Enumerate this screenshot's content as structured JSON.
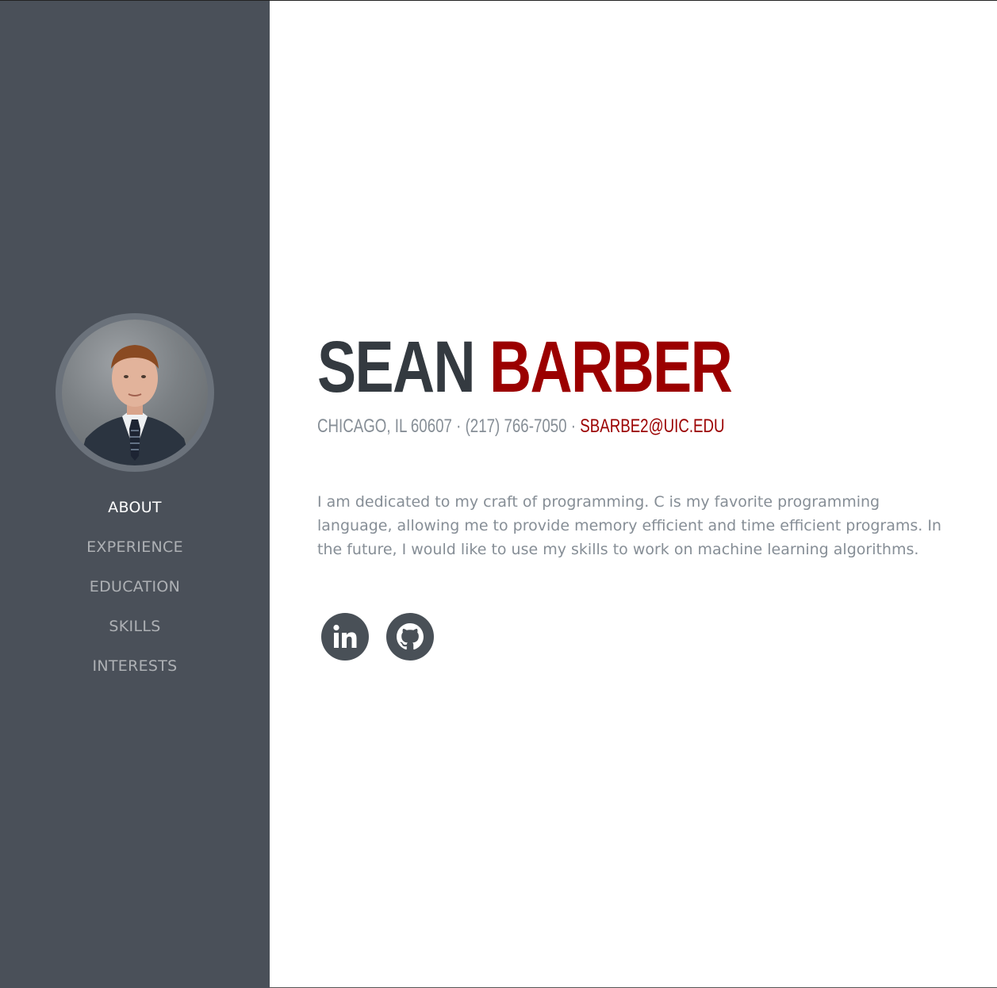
{
  "profile": {
    "first_name": "SEAN",
    "last_name": "BARBER",
    "location_phone": "CHICAGO, IL 60607 · (217) 766-7050 · ",
    "email": "SBARBE2@UIC.EDU",
    "bio": "I am dedicated to my craft of programming. C is my favorite programming language, allowing me to provide memory efficient and time efficient programs. In the future, I would like to use my skills to work on machine learning algorithms."
  },
  "nav": {
    "items": [
      {
        "label": "ABOUT",
        "active": true
      },
      {
        "label": "EXPERIENCE",
        "active": false
      },
      {
        "label": "EDUCATION",
        "active": false
      },
      {
        "label": "SKILLS",
        "active": false
      },
      {
        "label": "INTERESTS",
        "active": false
      }
    ]
  },
  "social": {
    "icons": [
      "linkedin-icon",
      "github-icon"
    ]
  },
  "colors": {
    "sidebar": "#4a5059",
    "accent": "#9b0000",
    "heading": "#343a40",
    "muted": "#868e96",
    "icon_bg": "#495057"
  }
}
